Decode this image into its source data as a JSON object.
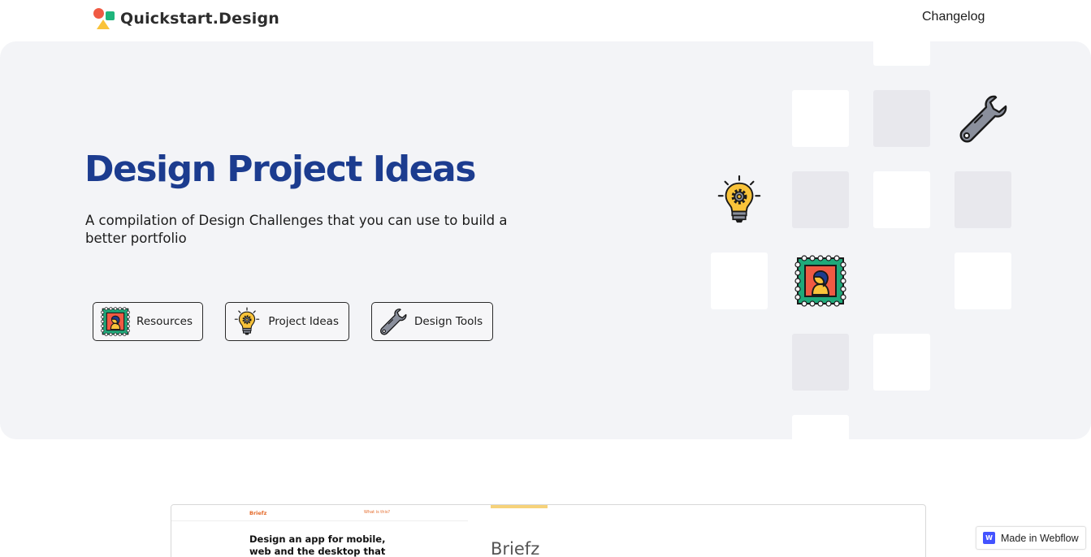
{
  "header": {
    "logo_text": "Quickstart.Design",
    "nav_changelog": "Changelog"
  },
  "hero": {
    "title": "Design Project Ideas",
    "subtitle": "A compilation of Design Challenges that you can use to build a better portfolio",
    "buttons": [
      {
        "label": "Resources",
        "icon": "stamp-icon"
      },
      {
        "label": "Project Ideas",
        "icon": "lightbulb-gear-icon"
      },
      {
        "label": "Design Tools",
        "icon": "wrench-icon"
      }
    ],
    "decor_icons": [
      "wrench-icon",
      "lightbulb-gear-icon",
      "stamp-icon"
    ]
  },
  "card": {
    "preview_brand": "Briefz",
    "preview_link": "What is this?",
    "preview_headline": "Design an app for mobile, web and the desktop that",
    "title": "Briefz"
  },
  "badge": {
    "label": "Made in Webflow",
    "logo_letter": "W"
  },
  "colors": {
    "title_blue": "#1c3c8f",
    "hero_bg": "#f3f4f7",
    "tile_grey": "#e8e8ed",
    "accent_yellow": "#f6d27a",
    "webflow_blue": "#4353ff"
  }
}
